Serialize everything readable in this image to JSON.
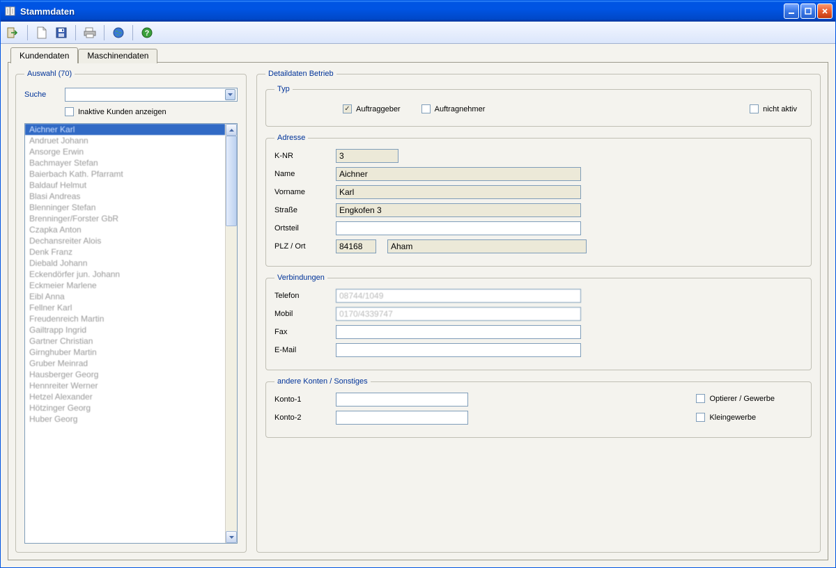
{
  "window": {
    "title": "Stammdaten"
  },
  "toolbar": {
    "icons": [
      "exit-icon",
      "new-icon",
      "save-icon",
      "print-icon",
      "world-icon",
      "help-icon"
    ]
  },
  "tabs": {
    "active": "Kundendaten",
    "inactive": "Maschinendaten"
  },
  "auswahl": {
    "legend": "Auswahl (70)",
    "search_label": "Suche",
    "inactive_label": "Inaktive Kunden anzeigen",
    "items": [
      "Aichner Karl",
      "Andruet Johann",
      "Ansorge Erwin",
      "Bachmayer Stefan",
      "Baierbach Kath. Pfarramt",
      "Baldauf Helmut",
      "Blasi Andreas",
      "Blenninger Stefan",
      "Brenninger/Forster GbR",
      "Czapka Anton",
      "Dechansreiter Alois",
      "Denk Franz",
      "Diebald Johann",
      "Eckendörfer jun. Johann",
      "Eckmeier Marlene",
      "Eibl Anna",
      "Fellner Karl",
      "Freudenreich Martin",
      "Gailtrapp Ingrid",
      "Gartner Christian",
      "Girnghuber Martin",
      "Gruber Meinrad",
      "Hausberger Georg",
      "Hennreiter Werner",
      "Hetzel Alexander",
      "Hötzinger Georg",
      "Huber Georg"
    ],
    "selected_index": 0
  },
  "detail": {
    "legend": "Detaildaten Betrieb",
    "typ": {
      "legend": "Typ",
      "auftraggeber_label": "Auftraggeber",
      "auftraggeber_checked": true,
      "auftragnehmer_label": "Auftragnehmer",
      "auftragnehmer_checked": false,
      "nicht_aktiv_label": "nicht aktiv",
      "nicht_aktiv_checked": false
    },
    "adresse": {
      "legend": "Adresse",
      "knr_label": "K-NR",
      "knr": "3",
      "name_label": "Name",
      "name": "Aichner",
      "vorname_label": "Vorname",
      "vorname": "Karl",
      "strasse_label": "Straße",
      "strasse": "Engkofen 3",
      "ortsteil_label": "Ortsteil",
      "ortsteil": "",
      "plzort_label": "PLZ / Ort",
      "plz": "84168",
      "ort": "Aham"
    },
    "verbindungen": {
      "legend": "Verbindungen",
      "telefon_label": "Telefon",
      "telefon": "08744/1049",
      "mobil_label": "Mobil",
      "mobil": "0170/4339747",
      "fax_label": "Fax",
      "fax": "",
      "email_label": "E-Mail",
      "email": ""
    },
    "sonstiges": {
      "legend": "andere Konten / Sonstiges",
      "konto1_label": "Konto-1",
      "konto1": "",
      "konto2_label": "Konto-2",
      "konto2": "",
      "optierer_label": "Optierer / Gewerbe",
      "klein_label": "Kleingewerbe"
    }
  }
}
